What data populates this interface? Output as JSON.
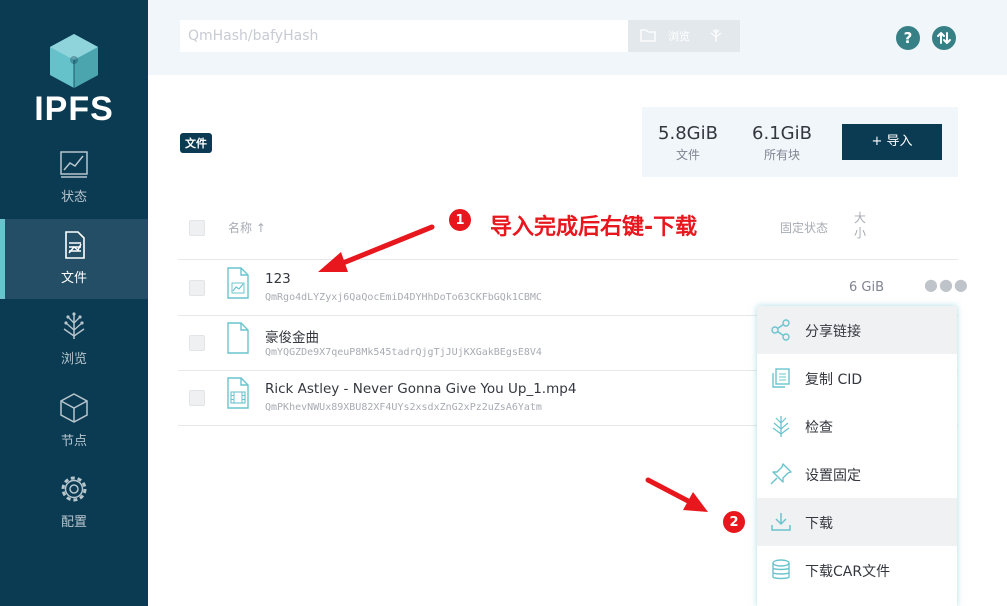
{
  "colors": {
    "sidebar": "#0b3a53",
    "sidebar_active": "#244e66",
    "accent": "#69c4cd",
    "header": "#f0f6fa",
    "annotation": "#e8161d"
  },
  "app": {
    "logo_text": "IPFS"
  },
  "sidebar": {
    "items": [
      {
        "label": "状态",
        "icon": "status-chart-icon"
      },
      {
        "label": "文件",
        "icon": "files-document-icon",
        "active": true
      },
      {
        "label": "浏览",
        "icon": "explore-tree-icon"
      },
      {
        "label": "节点",
        "icon": "peers-cube-icon"
      },
      {
        "label": "配置",
        "icon": "settings-gear-icon"
      }
    ]
  },
  "header": {
    "search_placeholder": "QmHash/bafyHash",
    "browse_label": "浏览"
  },
  "files": {
    "badge": "文件",
    "stats": [
      {
        "value": "5.8GiB",
        "label": "文件"
      },
      {
        "value": "6.1GiB",
        "label": "所有块"
      }
    ],
    "import_label": "+ 导入",
    "columns": {
      "name": "名称 ↑",
      "pin": "固定状态",
      "size": "大小"
    },
    "rows": [
      {
        "name": "123",
        "hash": "QmRgo4dLYZyxj6QaQocEmiD4DYHhDoTo63CKFbGQk1CBMC",
        "size": "6 GiB",
        "icon": "chart-file-icon"
      },
      {
        "name": "豪俊金曲",
        "hash": "QmYQGZDe9X7qeuP8Mk545tadrQjgTjJUjKXGakBEgsE8V4",
        "size": "",
        "icon": "file-icon"
      },
      {
        "name": "Rick Astley - Never Gonna Give You Up_1.mp4",
        "hash": "QmPKhevNWUx89XBU82XF4UYs2xsdxZnG2xPz2uZsA6Yatm",
        "size": "",
        "icon": "video-file-icon"
      }
    ]
  },
  "context_menu": {
    "items": [
      {
        "label": "分享链接",
        "icon": "share-icon"
      },
      {
        "label": "复制 CID",
        "icon": "copy-icon"
      },
      {
        "label": "检查",
        "icon": "inspect-tree-icon"
      },
      {
        "label": "设置固定",
        "icon": "pin-icon"
      },
      {
        "label": "下载",
        "icon": "download-icon",
        "highlighted": true
      },
      {
        "label": "下载CAR文件",
        "icon": "database-icon"
      }
    ]
  },
  "annotations": {
    "step1": "1",
    "step1_text": "导入完成后右键-下载",
    "step2": "2"
  }
}
